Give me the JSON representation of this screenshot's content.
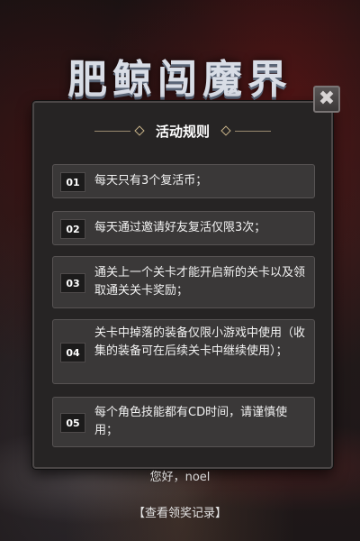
{
  "game": {
    "title": "肥鲸闯魔界"
  },
  "dialog": {
    "title": "活动规则",
    "close_label": "✖",
    "rules": [
      {
        "num": "01",
        "text": "每天只有3个复活币；"
      },
      {
        "num": "02",
        "text": "每天通过邀请好友复活仅限3次；"
      },
      {
        "num": "03",
        "text": "通关上一个关卡才能开启新的关卡以及领取通关关卡奖励；"
      },
      {
        "num": "04",
        "text": "关卡中掉落的装备仅限小游戏中使用（收集的装备可在后续关卡中继续使用）；"
      },
      {
        "num": "05",
        "text": "每个角色技能都有CD时间，请谨慎使用；"
      }
    ]
  },
  "footer": {
    "greeting": "您好，noel",
    "record_link": "【查看领奖记录】"
  }
}
